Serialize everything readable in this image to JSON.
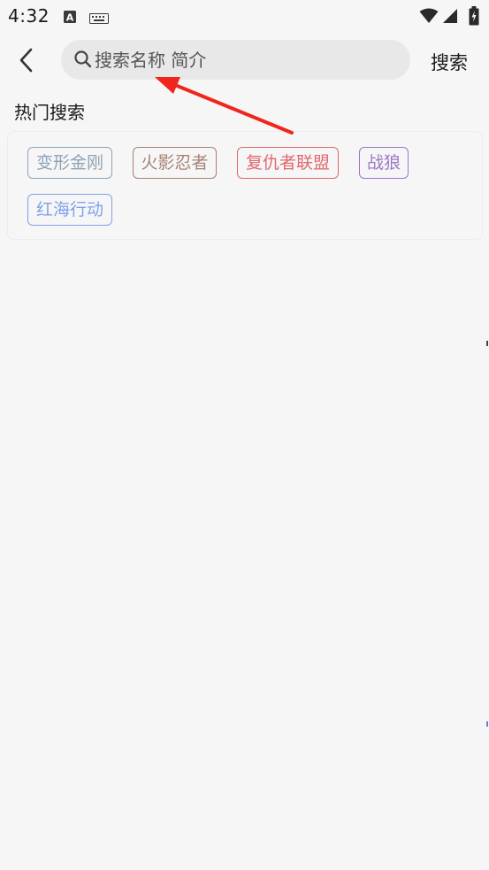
{
  "status_bar": {
    "time": "4:32",
    "icons": [
      "text-a-icon",
      "keyboard-icon",
      "wifi-icon",
      "cellular-signal-icon",
      "battery-charging-icon"
    ]
  },
  "nav": {
    "back_icon": "chevron-left-icon",
    "search_icon": "magnifier-icon",
    "search_placeholder": "搜索名称 简介",
    "search_value": "",
    "search_button_label": "搜索"
  },
  "hot_search": {
    "title": "热门搜索",
    "tags": [
      {
        "label": "变形金刚",
        "color": "#8fa3b8"
      },
      {
        "label": "火影忍者",
        "color": "#a68378"
      },
      {
        "label": "复仇者联盟",
        "color": "#e06870"
      },
      {
        "label": "战狼",
        "color": "#9b78c8"
      },
      {
        "label": "红海行动",
        "color": "#7ea2e8"
      }
    ]
  },
  "annotation": {
    "arrow_color": "#f0261c"
  }
}
